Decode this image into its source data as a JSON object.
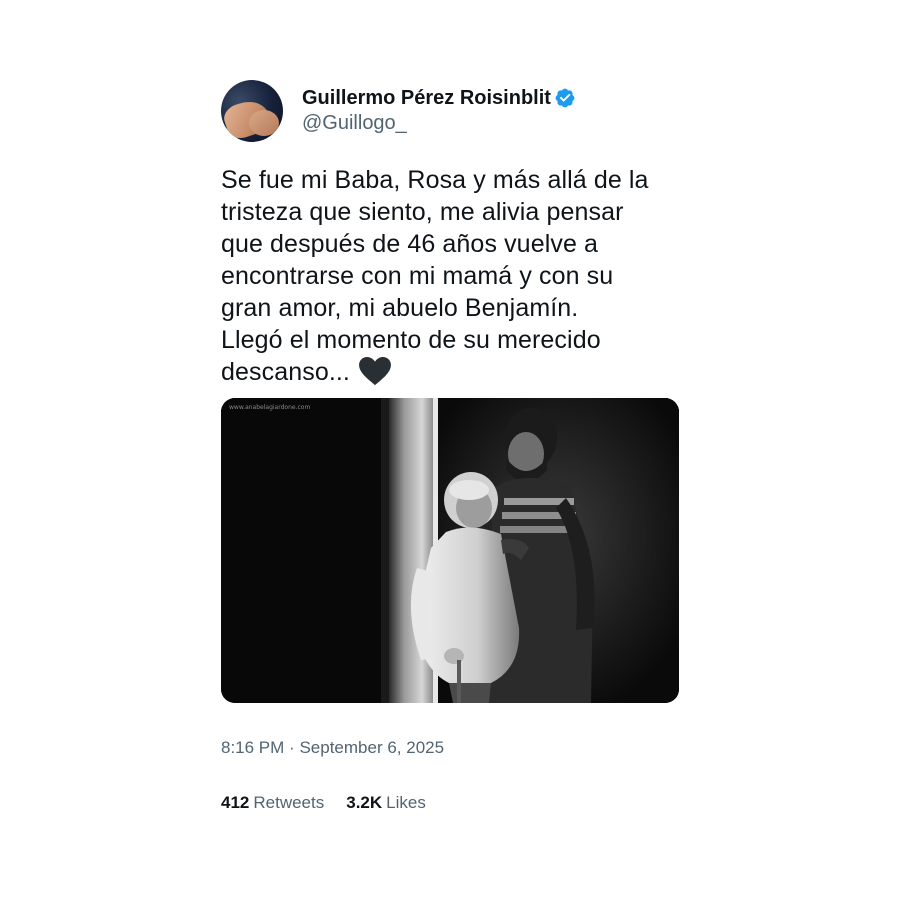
{
  "author": {
    "display_name": "Guillermo Pérez Roisinblit",
    "handle": "@Guillogo_",
    "verified": true,
    "verified_color": "#1d9bf0",
    "avatar_icon": "profile-avatar"
  },
  "tweet": {
    "text": "Se fue mi Baba, Rosa y más allá de la\ntristeza que siento, me alivia pensar\nque después de 46 años vuelve a\nencontrarse con mi mamá y con su\ngran amor, mi abuelo Benjamín.\nLlegó el momento de su merecido\ndescanso...",
    "emoji": "black-heart-icon",
    "photo": {
      "watermark": "www.anabelagiardone.com",
      "icon": "tweet-photo"
    }
  },
  "meta": {
    "time": "8:16 PM",
    "separator": "·",
    "date": "September 6, 2025"
  },
  "stats": {
    "retweets_count": "412",
    "retweets_label": "Retweets",
    "likes_count": "3.2K",
    "likes_label": "Likes"
  },
  "colors": {
    "text": "#0f1419",
    "secondary": "#536471",
    "verified": "#1d9bf0"
  }
}
